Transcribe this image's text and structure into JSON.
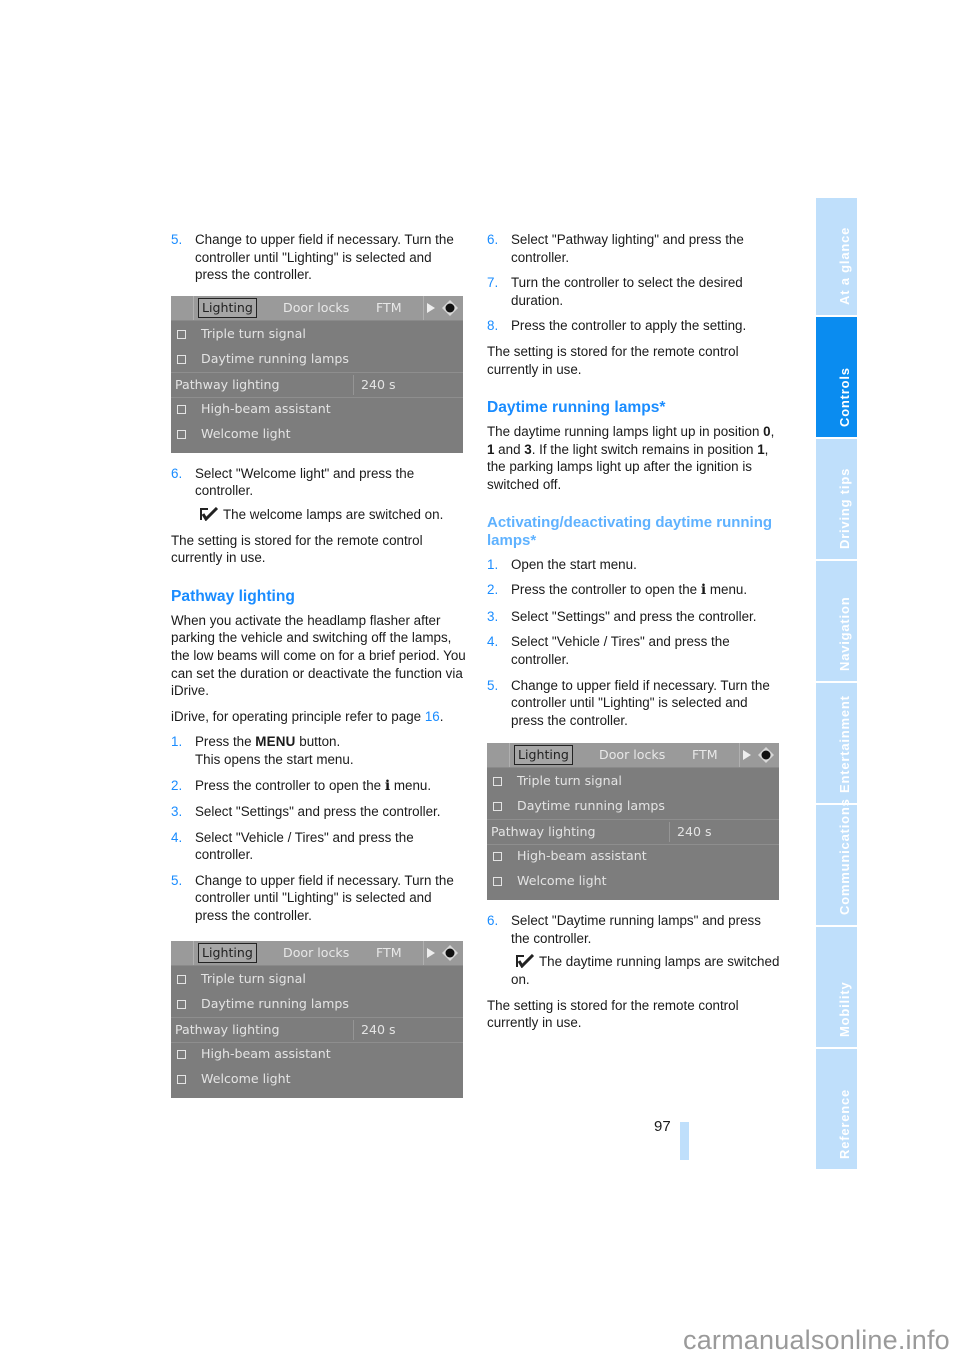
{
  "idrive_screen": {
    "tabs": [
      "Lighting",
      "Door locks",
      "FTM"
    ],
    "active_tab": "Lighting",
    "items": [
      {
        "type": "checkbox",
        "label": "Triple turn signal"
      },
      {
        "type": "checkbox",
        "label": "Daytime running lamps"
      },
      {
        "type": "field",
        "label": "Pathway lighting",
        "value": "240 s"
      },
      {
        "type": "checkbox",
        "label": "High-beam assistant"
      },
      {
        "type": "checkbox",
        "label": "Welcome light"
      }
    ]
  },
  "left_column": {
    "step5_top": {
      "num": "5.",
      "text": "Change to upper field if necessary. Turn the controller until \"Lighting\" is selected and press the controller."
    },
    "step6": {
      "num": "6.",
      "text": "Select \"Welcome light\" and press the controller."
    },
    "step6_note": "The welcome lamps are switched on.",
    "stored_note": "The setting is stored for the remote control currently in use.",
    "pathway_heading": "Pathway lighting",
    "pathway_intro": "When you activate the headlamp flasher after parking the vehicle and switching off the lamps, the low beams will come on for a brief period. You can set the duration or deactivate the function via iDrive.",
    "idrive_ref_text": "iDrive, for operating principle refer to page ",
    "idrive_ref_page": "16",
    "idrive_ref_end": ".",
    "steps": [
      {
        "num": "1.",
        "pre": "Press the ",
        "key": "MENU",
        "post": " button.",
        "sub": "This opens the start menu."
      },
      {
        "num": "2.",
        "pre": "Press the controller to open the ",
        "icon": "i",
        "post": " menu."
      },
      {
        "num": "3.",
        "text": "Select \"Settings\" and press the controller."
      },
      {
        "num": "4.",
        "text": "Select \"Vehicle / Tires\" and press the controller."
      },
      {
        "num": "5.",
        "text": "Change to upper field if necessary. Turn the controller until \"Lighting\" is selected and press the controller."
      }
    ]
  },
  "right_column": {
    "steps_top": [
      {
        "num": "6.",
        "text": "Select \"Pathway lighting\" and press the controller."
      },
      {
        "num": "7.",
        "text": "Turn the controller to select the desired duration."
      },
      {
        "num": "8.",
        "text": "Press the controller to apply the setting."
      }
    ],
    "stored_note": "The setting is stored for the remote control currently in use.",
    "drl_heading": "Daytime running lamps*",
    "drl_text": {
      "a": "The daytime running lamps light up in position ",
      "b0": "0",
      "c": ", ",
      "b1": "1",
      "d": " and ",
      "b3": "3",
      "e": ". If the light switch remains in position ",
      "b1b": "1",
      "f": ", the parking lamps light up after the ignition is switched off."
    },
    "activating_heading": "Activating/deactivating daytime running lamps*",
    "steps": [
      {
        "num": "1.",
        "text": "Open the start menu."
      },
      {
        "num": "2.",
        "pre": "Press the controller to open the ",
        "icon": "i",
        "post": " menu."
      },
      {
        "num": "3.",
        "text": "Select \"Settings\" and press the controller."
      },
      {
        "num": "4.",
        "text": "Select \"Vehicle / Tires\" and press the controller."
      },
      {
        "num": "5.",
        "text": "Change to upper field if necessary. Turn the controller until \"Lighting\" is selected and press the controller."
      }
    ],
    "step6": {
      "num": "6.",
      "text": "Select \"Daytime running lamps\" and press the controller."
    },
    "step6_note": "The daytime running lamps are switched on.",
    "stored_note_2": "The setting is stored for the remote control currently in use."
  },
  "page_number": "97",
  "sidebar": {
    "active": "Controls",
    "tabs": [
      "At a glance",
      "Controls",
      "Driving tips",
      "Navigation",
      "Entertainment",
      "Communications",
      "Mobility",
      "Reference"
    ]
  },
  "colors": {
    "accent": "#1a8cff",
    "sidebar_active": "#0a8cf0",
    "sidebar_inactive": "#bfdffb"
  },
  "watermark": "carmanualsonline.info"
}
